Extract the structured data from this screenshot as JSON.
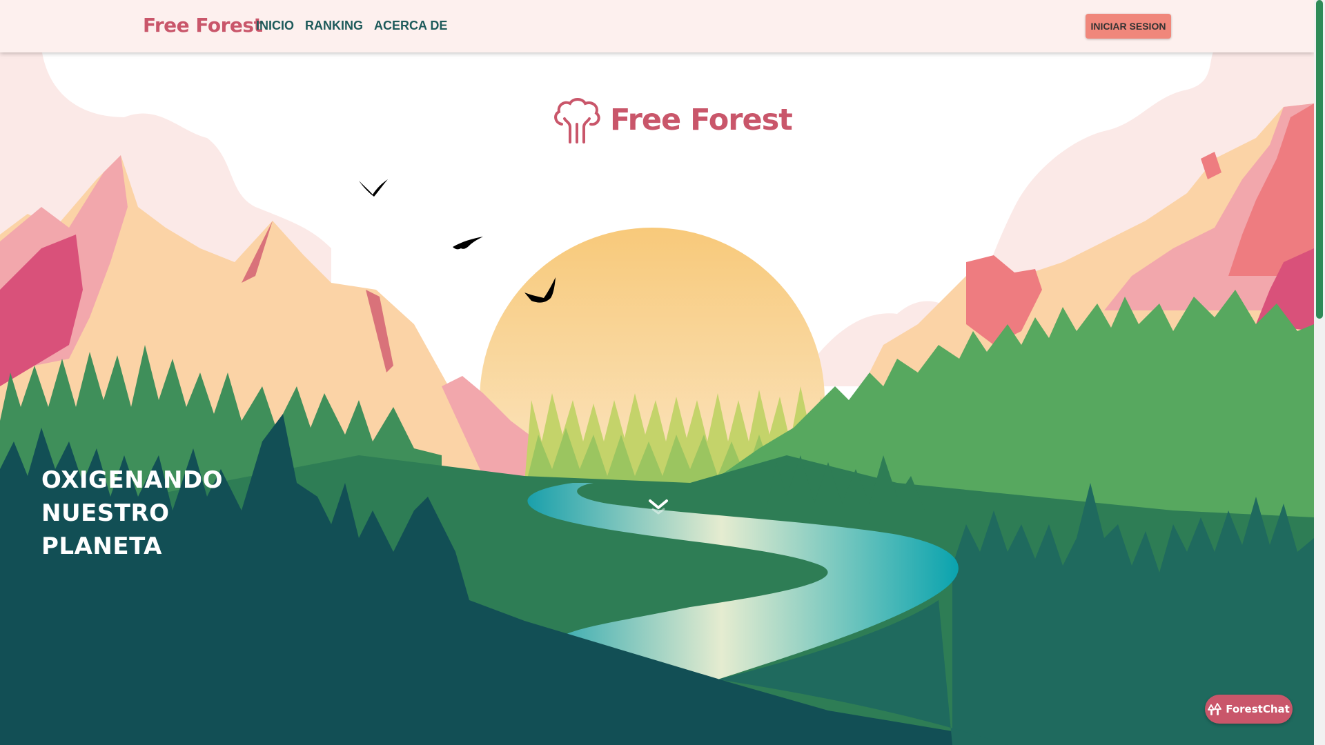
{
  "navbar": {
    "brand": "Free Forest",
    "links": [
      "INICIO",
      "RANKING",
      "ACERCA DE"
    ],
    "login_label": "INICIAR SESION"
  },
  "hero": {
    "logo_text": "Free Forest",
    "title_lines": [
      "OXIGENANDO",
      "NUESTRO",
      "PLANETA"
    ],
    "scroll_icon": "chevron-down-icon"
  },
  "chat": {
    "label": "ForestChat",
    "icon": "tree-icon"
  },
  "colors": {
    "brand": "#c9566a",
    "nav_bg": "#fdf0ee",
    "nav_link": "#1d5a5a",
    "login_bg": "#f0877b",
    "sun": "#f8cd7e",
    "forest_dark": "#124f55",
    "forest_mid": "#2e7d55",
    "forest_light": "#57a85f",
    "river": "#2ab0b8"
  }
}
